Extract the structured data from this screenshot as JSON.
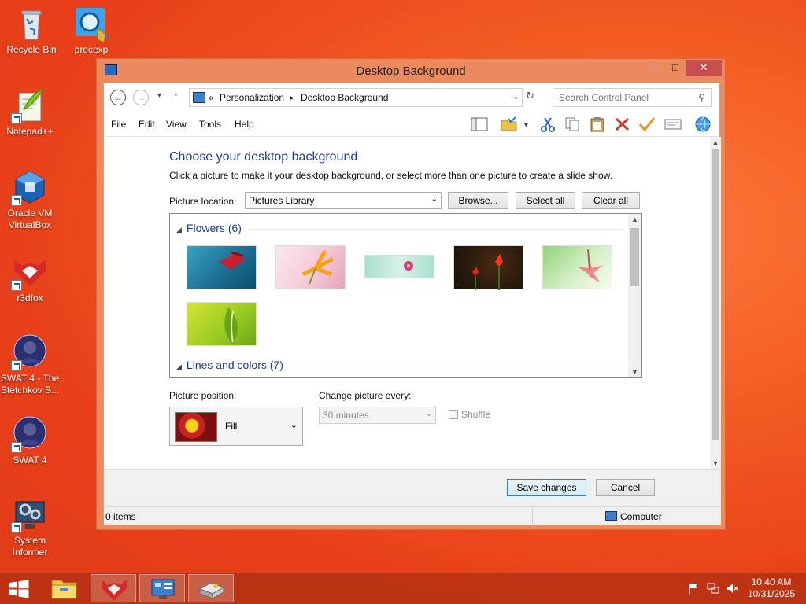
{
  "desktop": {
    "icons": [
      {
        "label": "Recycle Bin",
        "icon": "recycle-bin-icon"
      },
      {
        "label": "procexp",
        "icon": "process-explorer-icon"
      },
      {
        "label": "Notepad++",
        "icon": "notepad-plus-plus-icon"
      },
      {
        "label": "Oracle VM VirtualBox",
        "icon": "virtualbox-icon"
      },
      {
        "label": "r3dfox",
        "icon": "r3dfox-icon"
      },
      {
        "label": "SWAT 4 - The Stetchkov S...",
        "icon": "swat4-icon"
      },
      {
        "label": "SWAT 4",
        "icon": "swat4-icon"
      },
      {
        "label": "System Informer",
        "icon": "system-informer-icon"
      }
    ]
  },
  "window": {
    "title": "Desktop Background",
    "controls": {
      "minimize": "–",
      "maximize": "□",
      "close": "✕"
    }
  },
  "navbar": {
    "back": "←",
    "forward": "→",
    "recent": "▾",
    "up": "↑",
    "breadcrumb_prefix": "«",
    "breadcrumb": [
      "Personalization",
      "Desktop Background"
    ],
    "separator": "▸",
    "dropdown": "⌄",
    "refresh": "↻",
    "search_placeholder": "Search Control Panel",
    "search_icon": "⚲"
  },
  "menu": [
    "File",
    "Edit",
    "View",
    "Tools",
    "Help"
  ],
  "toolbar_icons": [
    "layout-icon",
    "folder-check-icon",
    "cut-icon",
    "copy-icon",
    "paste-icon",
    "delete-icon",
    "checkmark-icon",
    "properties-icon",
    "globe-icon"
  ],
  "content": {
    "heading": "Choose your desktop background",
    "subheading": "Click a picture to make it your desktop background, or select more than one picture to create a slide show.",
    "location_label": "Picture location:",
    "location_value": "Pictures Library",
    "browse_label": "Browse...",
    "select_all_label": "Select all",
    "clear_all_label": "Clear all",
    "groups": [
      {
        "name": "Flowers (6)",
        "collapse_glyph": "◢"
      },
      {
        "name": "Lines and colors (7)",
        "collapse_glyph": "◢"
      }
    ],
    "position_label": "Picture position:",
    "position_value": "Fill",
    "change_label": "Change picture every:",
    "change_value": "30 minutes",
    "shuffle_label": "Shuffle",
    "scroll_up": "▲",
    "scroll_down": "▼"
  },
  "footer": {
    "save_label": "Save changes",
    "cancel_label": "Cancel"
  },
  "statusbar": {
    "items": "0 items",
    "location": "Computer"
  },
  "taskbar": {
    "time": "10:40 AM",
    "date": "10/31/2025",
    "tray_icons": [
      "flag-icon",
      "network-icon",
      "volume-muted-icon"
    ]
  },
  "colors": {
    "accent": "#1e3d8f",
    "window_frame": "#eb8a5e",
    "close_button": "#c74e4e",
    "taskbar": "#b93214"
  }
}
